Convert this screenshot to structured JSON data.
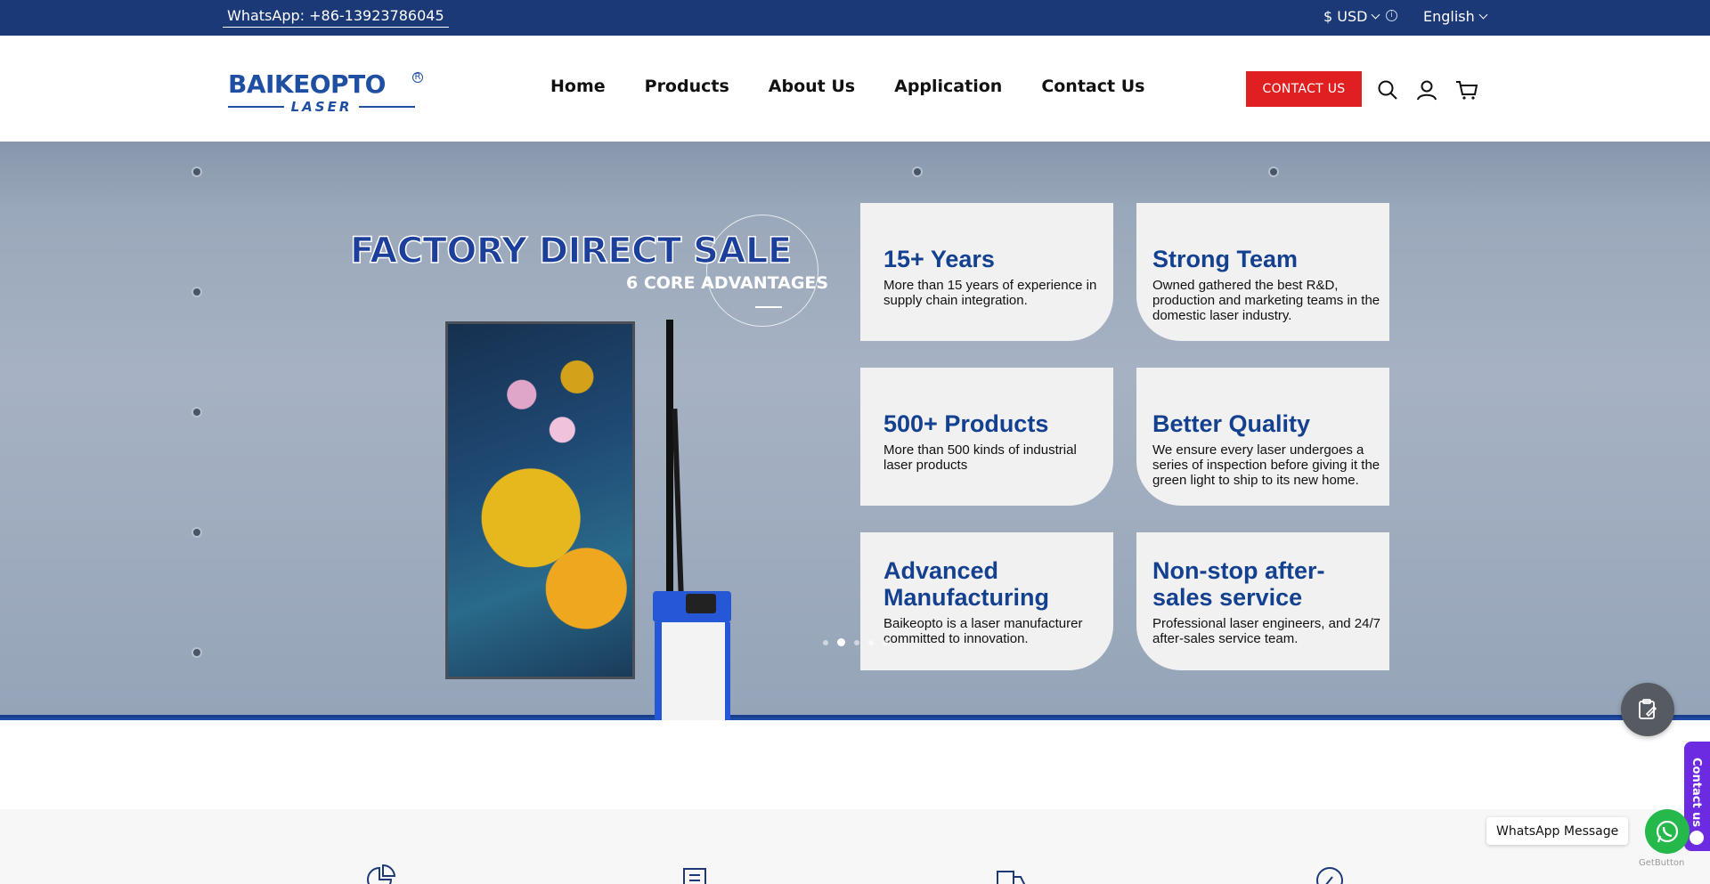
{
  "topbar": {
    "whatsapp": "WhatsApp: +86-13923786045",
    "currency": "$ USD",
    "language": "English"
  },
  "header": {
    "logo_main": "BAIKEOPTO",
    "logo_sub": "LASER",
    "nav": [
      "Home",
      "Products",
      "About Us",
      "Application",
      "Contact Us"
    ],
    "cta": "CONTACT US",
    "icons": [
      "search-icon",
      "account-icon",
      "cart-icon"
    ]
  },
  "hero": {
    "title": "FACTORY DIRECT SALE",
    "subtitle": "6 CORE ADVANTAGES",
    "cards": [
      {
        "title": "15+ Years",
        "text": "More than 15 years of experience in supply chain integration."
      },
      {
        "title": "Strong Team",
        "text": "Owned gathered the best R&D, production and marketing teams in the domestic laser industry."
      },
      {
        "title": "500+ Products",
        "text": "More than 500 kinds of industrial laser products"
      },
      {
        "title": "Better Quality",
        "text": "We ensure every laser undergoes a series of inspection before giving it the green light to ship to its new home."
      },
      {
        "title": "Advanced Manufacturing",
        "text": "Baikeopto is a laser manufacturer committed to innovation."
      },
      {
        "title": "Non-stop after-sales service",
        "text": "Professional laser engineers, and 24/7 after-sales service team."
      }
    ],
    "slides": 5,
    "active_slide": 2
  },
  "widgets": {
    "contact_tab": "Contact us",
    "whatsapp_label": "WhatsApp Message",
    "getbutton": "GetButton"
  },
  "colors": {
    "topbar": "#1b3877",
    "brand_blue": "#1f4fa3",
    "cta_red": "#e02020",
    "stripe_blue": "#1d4aa3",
    "whatsapp_green": "#25b84a"
  }
}
